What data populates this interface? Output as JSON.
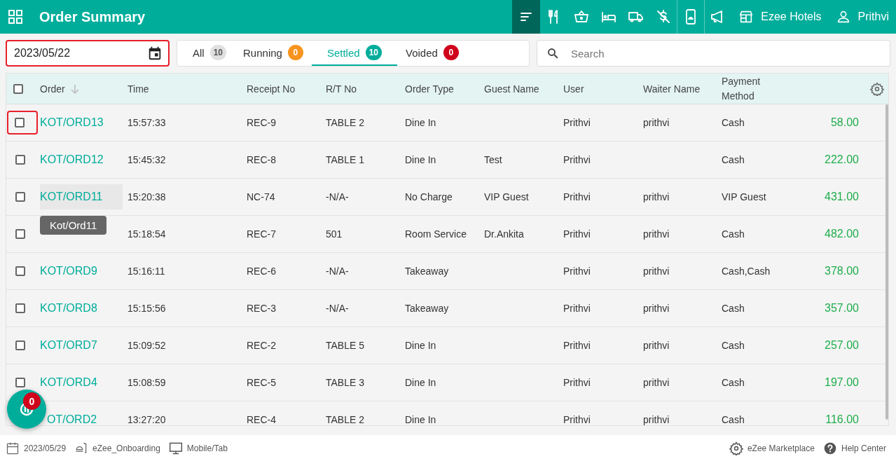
{
  "header": {
    "title": "Order Summary",
    "nav_icons": [
      {
        "kind": "sort",
        "selected": true
      },
      {
        "kind": "fork",
        "selected": false
      },
      {
        "kind": "basket",
        "selected": false
      },
      {
        "kind": "bed",
        "selected": false
      },
      {
        "kind": "truck",
        "selected": false
      },
      {
        "kind": "nodollar",
        "selected": false
      },
      {
        "kind": "phone",
        "selected": false
      },
      {
        "kind": "megaphone",
        "selected": false
      }
    ],
    "property": "Ezee Hotels",
    "user": "Prithvi"
  },
  "date_field": {
    "value": "2023/05/22",
    "highlighted": true
  },
  "tabs": [
    {
      "label": "All",
      "count": "10",
      "color": "#e0e0e0",
      "selected": false
    },
    {
      "label": "Running",
      "count": "0",
      "color": "#f7931e",
      "selected": false
    },
    {
      "label": "Settled",
      "count": "10",
      "color": "#00ad9b",
      "selected": true
    },
    {
      "label": "Voided",
      "count": "0",
      "color": "#d0021b",
      "selected": false
    }
  ],
  "search": {
    "placeholder": "Search"
  },
  "table": {
    "select_all_checked": false,
    "columns": [
      "Order",
      "Time",
      "Receipt No",
      "R/T No",
      "Order Type",
      "Guest Name",
      "User",
      "Waiter Name",
      "Payment Method"
    ],
    "rows": [
      {
        "order": "KOT/ORD13",
        "time": "15:57:33",
        "receipt": "REC-9",
        "rt": "TABLE 2",
        "type": "Dine In",
        "guest": "",
        "user": "Prithvi",
        "waiter": "prithvi",
        "payment": "Cash",
        "amount": "58.00",
        "checked": false,
        "highlighted": true
      },
      {
        "order": "KOT/ORD12",
        "time": "15:45:32",
        "receipt": "REC-8",
        "rt": "TABLE 1",
        "type": "Dine In",
        "guest": "Test",
        "user": "Prithvi",
        "waiter": "",
        "payment": "Cash",
        "amount": "222.00",
        "checked": false,
        "highlighted": false
      },
      {
        "order": "KOT/ORD11",
        "time": "15:20:38",
        "receipt": "NC-74",
        "rt": "-N/A-",
        "type": "No Charge",
        "guest": "VIP Guest",
        "user": "Prithvi",
        "waiter": "prithvi",
        "payment": "VIP Guest",
        "amount": "431.00",
        "checked": false,
        "highlighted": false,
        "hovered": true,
        "tooltip": "Kot/Ord11"
      },
      {
        "order": "",
        "time": "15:18:54",
        "receipt": "REC-7",
        "rt": "501",
        "type": "Room Service",
        "guest": "Dr.Ankita",
        "user": "Prithvi",
        "waiter": "prithvi",
        "payment": "Cash",
        "amount": "482.00",
        "checked": false,
        "highlighted": false
      },
      {
        "order": "KOT/ORD9",
        "time": "15:16:11",
        "receipt": "REC-6",
        "rt": "-N/A-",
        "type": "Takeaway",
        "guest": "",
        "user": "Prithvi",
        "waiter": "prithvi",
        "payment": "Cash,Cash",
        "amount": "378.00",
        "checked": false,
        "highlighted": false
      },
      {
        "order": "KOT/ORD8",
        "time": "15:15:56",
        "receipt": "REC-3",
        "rt": "-N/A-",
        "type": "Takeaway",
        "guest": "",
        "user": "Prithvi",
        "waiter": "prithvi",
        "payment": "Cash",
        "amount": "357.00",
        "checked": false,
        "highlighted": false
      },
      {
        "order": "KOT/ORD7",
        "time": "15:09:52",
        "receipt": "REC-2",
        "rt": "TABLE 5",
        "type": "Dine In",
        "guest": "",
        "user": "Prithvi",
        "waiter": "prithvi",
        "payment": "Cash",
        "amount": "257.00",
        "checked": false,
        "highlighted": false
      },
      {
        "order": "KOT/ORD4",
        "time": "15:08:59",
        "receipt": "REC-5",
        "rt": "TABLE 3",
        "type": "Dine In",
        "guest": "",
        "user": "Prithvi",
        "waiter": "prithvi",
        "payment": "Cash",
        "amount": "197.00",
        "checked": false,
        "highlighted": false
      },
      {
        "order": "OT/ORD2",
        "time": "13:27:20",
        "receipt": "REC-4",
        "rt": "TABLE 2",
        "type": "Dine In",
        "guest": "",
        "user": "Prithvi",
        "waiter": "prithvi",
        "payment": "Cash",
        "amount": "116.00",
        "highlighted": false,
        "hovered": false,
        "partly_hidden": true
      }
    ]
  },
  "notification_fab": {
    "count": "0"
  },
  "footer": {
    "date": "2023/05/29",
    "outlet": "eZee_Onboarding",
    "device": "Mobile/Tab",
    "marketplace": "eZee Marketplace",
    "help": "Help Center"
  }
}
